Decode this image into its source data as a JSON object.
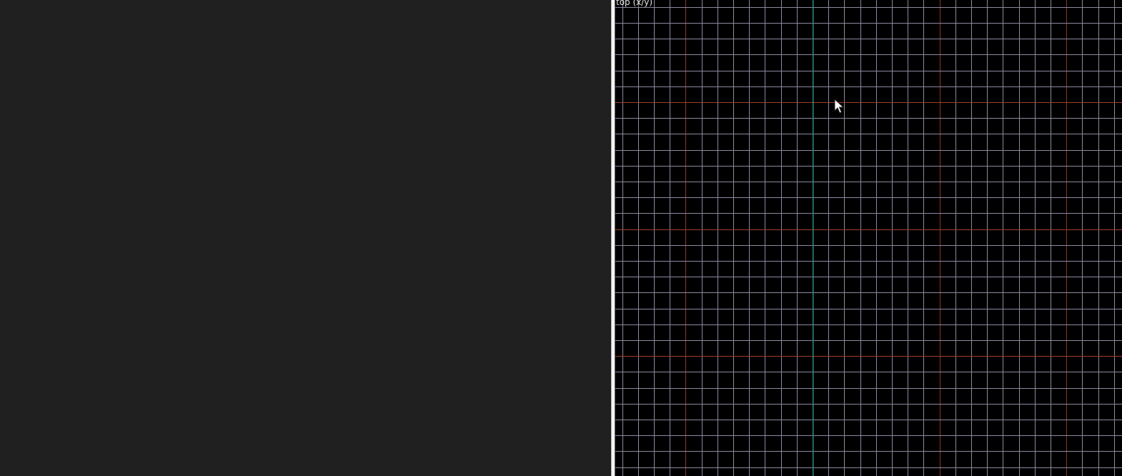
{
  "viewport": {
    "label": "top (x/y)",
    "background": "#000000",
    "grid": {
      "minor_color": "#8a8aa0",
      "major_horizontal_color": "#a04028",
      "major_vertical_color": "#8a3a2a",
      "axis_color": "#2e8a8a"
    }
  },
  "cursor": {
    "icon": "arrow-pointer-icon"
  }
}
